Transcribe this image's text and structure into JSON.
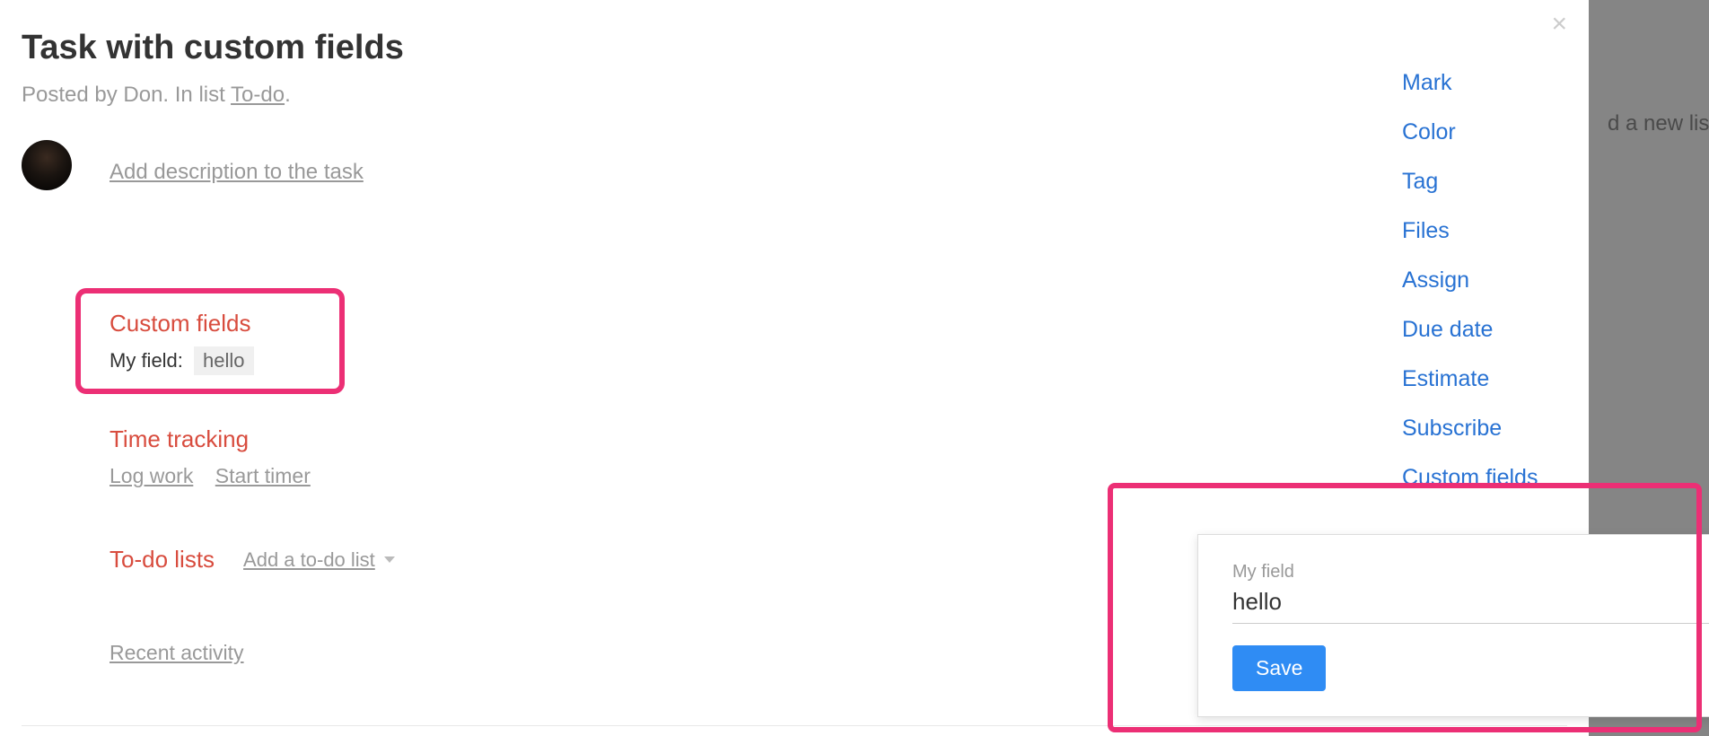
{
  "backdrop": {
    "add_list_text": "d a new list"
  },
  "modal": {
    "close_label": "×",
    "title": "Task with custom fields",
    "meta": {
      "prefix": "Posted by Don. In list ",
      "list_name": "To-do",
      "suffix": "."
    },
    "add_description": "Add description to the task",
    "custom_fields": {
      "heading": "Custom fields",
      "field_label": "My field:",
      "field_value": "hello"
    },
    "time_tracking": {
      "heading": "Time tracking",
      "log_work": "Log work",
      "start_timer": "Start timer"
    },
    "todo": {
      "heading": "To-do lists",
      "add_label": "Add a to-do list"
    },
    "recent_activity": "Recent activity"
  },
  "side_menu": {
    "items": [
      "Mark",
      "Color",
      "Tag",
      "Files",
      "Assign",
      "Due date",
      "Estimate",
      "Subscribe",
      "Custom fields"
    ]
  },
  "popover": {
    "label": "My field",
    "value": "hello",
    "save_label": "Save"
  }
}
